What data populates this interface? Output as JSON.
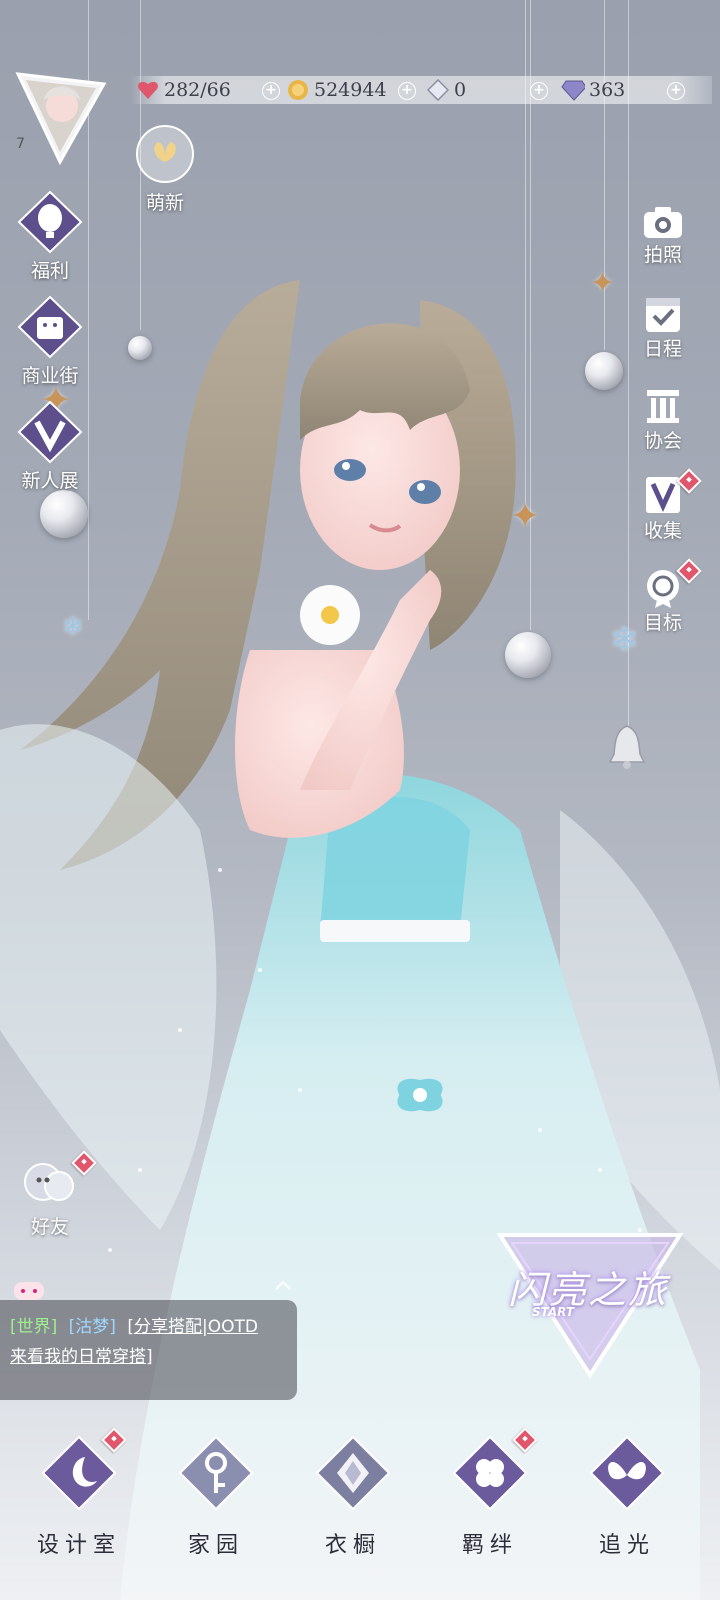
{
  "player": {
    "level": "7"
  },
  "currency": {
    "stamina": "282/66",
    "gold": "524944",
    "crystal": "0",
    "diamond": "363"
  },
  "left_menu": {
    "newbie_label": "萌新",
    "welfare_label": "福利",
    "shop_label": "商业街",
    "exhibit_label": "新人展",
    "friends_label": "好友"
  },
  "right_menu": {
    "photo_label": "拍照",
    "schedule_label": "日程",
    "guild_label": "协会",
    "collection_label": "收集",
    "goals_label": "目标"
  },
  "chat": {
    "channel": "[世界]",
    "sender": "[沽梦]",
    "message_part1": "[分享搭配|OOTD",
    "message_part2": "来看我的日常穿搭]"
  },
  "journey": {
    "title": "闪亮之旅",
    "start_label": "START"
  },
  "bottom_nav": {
    "design_label": "设计室",
    "home_label": "家园",
    "wardrobe_label": "衣橱",
    "bond_label": "羁绊",
    "chase_label": "追光"
  },
  "colors": {
    "background": "#a3a9b5",
    "badge_red": "#e0566c",
    "dress_cyan": "#7fd3e0",
    "icon_purple": "#6b5a9c"
  }
}
